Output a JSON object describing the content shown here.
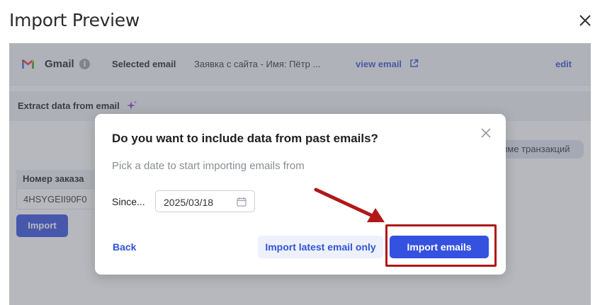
{
  "header": {
    "title": "Import Preview"
  },
  "email_bar": {
    "service": "Gmail",
    "info_glyph": "i",
    "selected_label": "Selected email",
    "selected_value": "Заявка с сайта - Имя: Пётр ...",
    "view_email": "view email",
    "edit": "edit"
  },
  "extract": {
    "label": "Extract data from email"
  },
  "background": {
    "chip_text": "име транзакций",
    "order_header": "Номер заказа",
    "order_value": "4HSYGEII90F0",
    "import_button": "Import"
  },
  "modal": {
    "title": "Do you want to include data from past emails?",
    "subtitle": "Pick a date to start importing emails from",
    "since_label": "Since...",
    "date_value": "2025/03/18",
    "back_button": "Back",
    "latest_button": "Import latest email only",
    "import_button": "Import emails"
  },
  "colors": {
    "accent": "#3451e0",
    "link": "#2f55d4",
    "annotation": "#b01818"
  },
  "icons": [
    "close-icon",
    "gmail-icon",
    "info-icon",
    "external-link-icon",
    "sparkle-icon",
    "calendar-icon",
    "arrow-annotation"
  ]
}
